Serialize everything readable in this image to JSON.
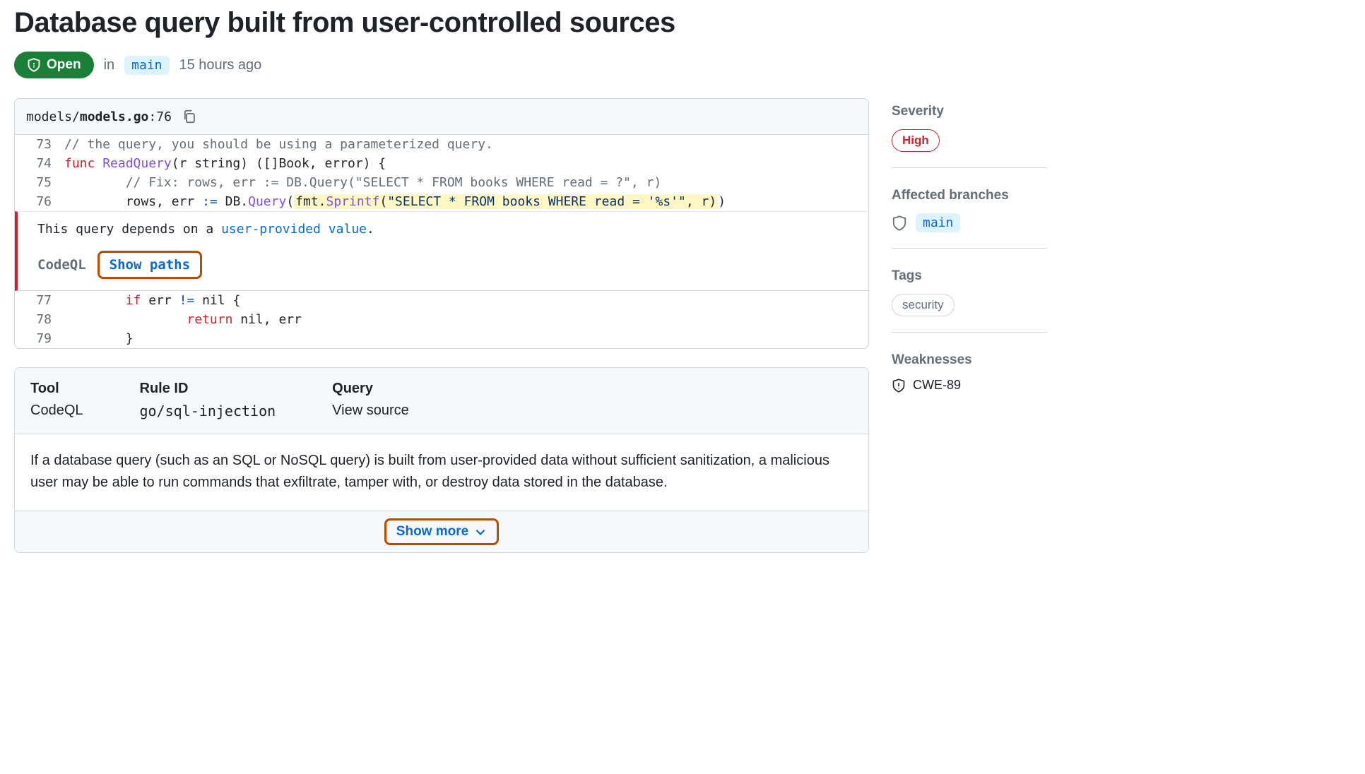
{
  "title": "Database query built from user-controlled sources",
  "status": {
    "label": "Open"
  },
  "meta": {
    "in": "in",
    "branch": "main",
    "time": "15 hours ago"
  },
  "file": {
    "path_prefix": "models/",
    "path_bold": "models.go",
    "line_sep": ":",
    "line": "76"
  },
  "lines": {
    "n73": "73",
    "n74": "74",
    "n75": "75",
    "n76": "76",
    "n77": "77",
    "n78": "78",
    "n79": "79"
  },
  "code": {
    "l73": "// the query, you should be using a parameterized query.",
    "l74_kw": "func",
    "l74_fn": " ReadQuery",
    "l74_rest": "(r string) ([]Book, error) {",
    "l75": "        // Fix: rows, err := DB.Query(\"SELECT * FROM books WHERE read = ?\", r)",
    "l76_pre": "        rows, err ",
    "l76_op": ":=",
    "l76_mid1": " DB.",
    "l76_call": "Query",
    "l76_paren": "(",
    "l76_hl_pre": "fmt.",
    "l76_hl_fn": "Sprintf",
    "l76_hl_paren": "(",
    "l76_hl_str": "\"SELECT * FROM books WHERE read = '%s'\"",
    "l76_hl_rest": ", r)",
    "l76_end": ")",
    "l77_pre": "        ",
    "l77_kw": "if",
    "l77_mid": " err ",
    "l77_op": "!=",
    "l77_rest": " nil {",
    "l78_pre": "                ",
    "l78_kw": "return",
    "l78_rest": " nil, err",
    "l79": "        }"
  },
  "annotation": {
    "prefix": "This query depends on a ",
    "link": "user-provided value",
    "suffix": ".",
    "tool": "CodeQL",
    "show_paths": "Show paths"
  },
  "info": {
    "tool_label": "Tool",
    "tool_val": "CodeQL",
    "rule_label": "Rule ID",
    "rule_val": "go/sql-injection",
    "query_label": "Query",
    "query_val": "View source",
    "body": "If a database query (such as an SQL or NoSQL query) is built from user-provided data without sufficient sanitization, a malicious user may be able to run commands that exfiltrate, tamper with, or destroy data stored in the database.",
    "show_more": "Show more"
  },
  "sidebar": {
    "severity_label": "Severity",
    "severity_val": "High",
    "affected_label": "Affected branches",
    "affected_branch": "main",
    "tags_label": "Tags",
    "tag1": "security",
    "weak_label": "Weaknesses",
    "weak1": "CWE-89"
  }
}
